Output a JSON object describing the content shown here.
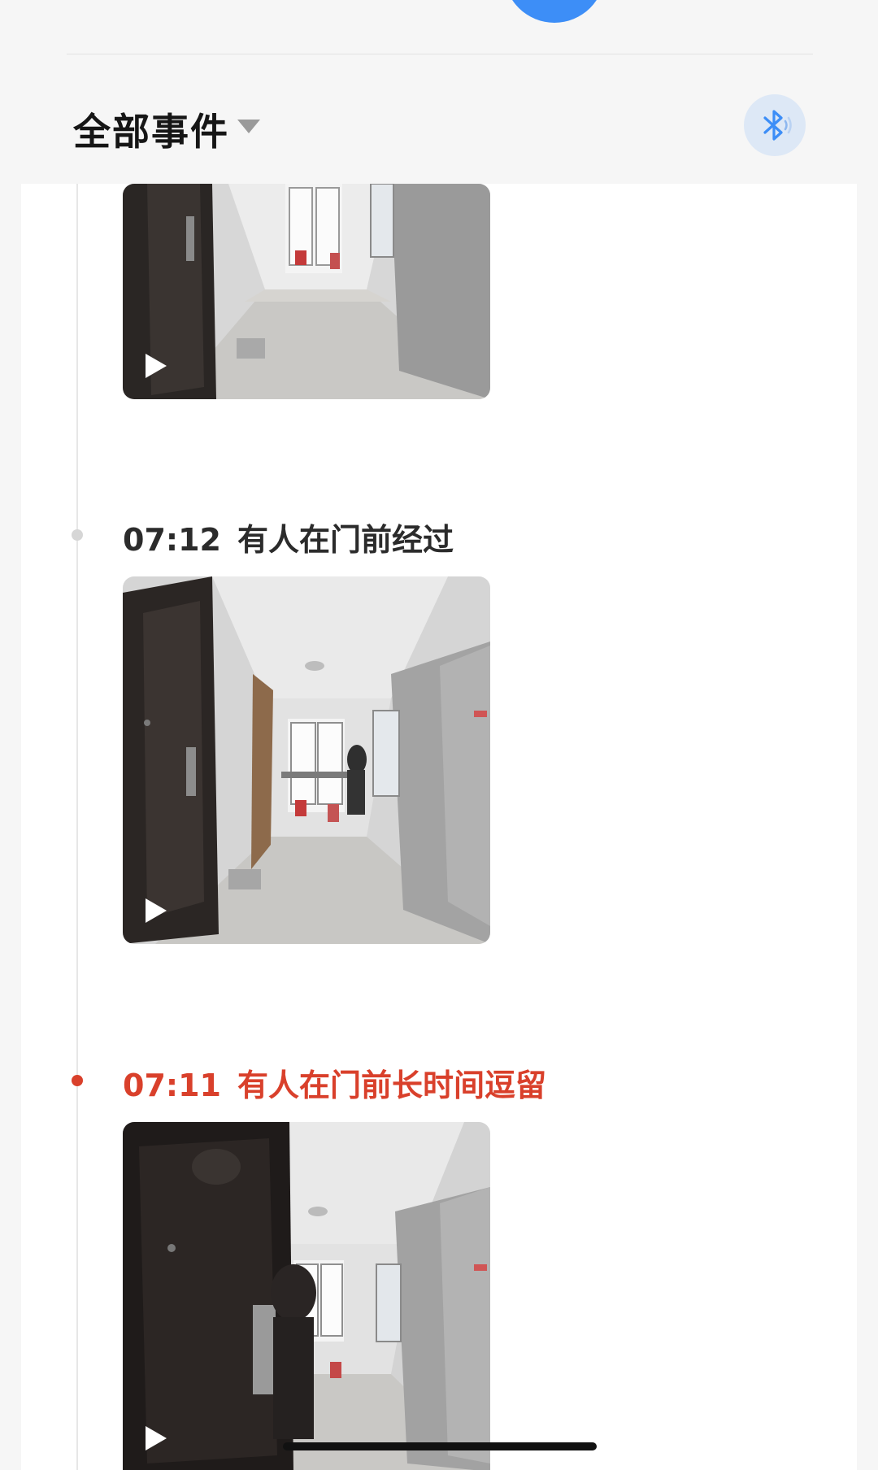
{
  "header": {
    "filter_label": "全部事件"
  },
  "events": [
    {
      "time": "",
      "description": "",
      "type": "motion"
    },
    {
      "time": "07:12",
      "description": "有人在门前经过",
      "type": "motion"
    },
    {
      "time": "07:11",
      "description": "有人在门前长时间逗留",
      "type": "alert"
    }
  ],
  "colors": {
    "accent_blue": "#3d8ef7",
    "alert_red": "#d9402b",
    "bluetooth_bg": "#dde8f6"
  },
  "icons": {
    "filter": "chevron-down-icon",
    "bluetooth": "bluetooth-icon",
    "play": "play-icon"
  }
}
